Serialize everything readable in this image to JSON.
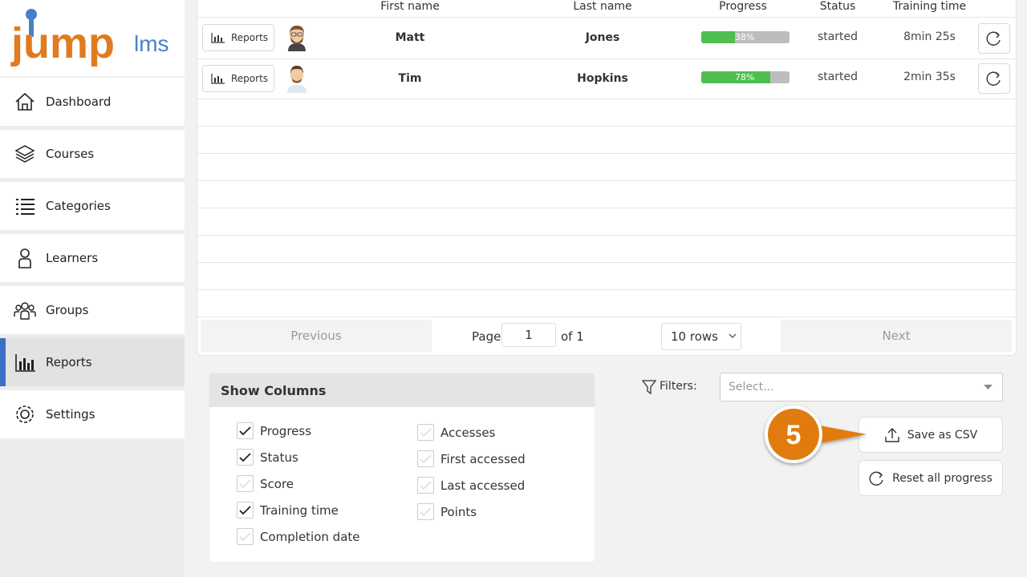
{
  "logo": {
    "jump": "jump",
    "lms": "lms"
  },
  "sidebar": {
    "items": [
      {
        "label": "Dashboard",
        "icon": "home-icon"
      },
      {
        "label": "Courses",
        "icon": "layers-icon"
      },
      {
        "label": "Categories",
        "icon": "list-icon"
      },
      {
        "label": "Learners",
        "icon": "user-icon"
      },
      {
        "label": "Groups",
        "icon": "users-icon"
      },
      {
        "label": "Reports",
        "icon": "bar-chart-icon"
      },
      {
        "label": "Settings",
        "icon": "gear-icon"
      }
    ],
    "active": "Reports",
    "accent": "#3a6fc4"
  },
  "table": {
    "headers": {
      "first_name": "First name",
      "last_name": "Last name",
      "progress": "Progress",
      "status": "Status",
      "training_time": "Training time"
    },
    "reports_label": "Reports",
    "rows": [
      {
        "first_name": "Matt",
        "last_name": "Jones",
        "progress": 38,
        "progress_label": "38%",
        "status": "started",
        "training_time": "8min 25s"
      },
      {
        "first_name": "Tim",
        "last_name": "Hopkins",
        "progress": 78,
        "progress_label": "78%",
        "status": "started",
        "training_time": "2min 35s"
      }
    ]
  },
  "pager": {
    "previous": "Previous",
    "page_label": "Page",
    "page_value": "1",
    "of_label": "of 1",
    "rows_label": "10 rows",
    "next": "Next"
  },
  "columns_panel": {
    "title": "Show Columns",
    "options": [
      {
        "label": "Progress",
        "checked": true
      },
      {
        "label": "Status",
        "checked": true
      },
      {
        "label": "Score",
        "checked": false
      },
      {
        "label": "Training time",
        "checked": true
      },
      {
        "label": "Completion date",
        "checked": false
      },
      {
        "label": "Accesses",
        "checked": false
      },
      {
        "label": "First accessed",
        "checked": false
      },
      {
        "label": "Last accessed",
        "checked": false
      },
      {
        "label": "Points",
        "checked": false
      }
    ]
  },
  "filters": {
    "label": "Filters:",
    "placeholder": "Select..."
  },
  "actions": {
    "save_csv": "Save as CSV",
    "reset_all": "Reset all progress"
  },
  "callout": {
    "number": "5",
    "color": "#e07b10"
  },
  "colors": {
    "progress_fill": "#4fbe4f",
    "logo_orange": "#e07b20",
    "logo_blue": "#4a80c8"
  }
}
